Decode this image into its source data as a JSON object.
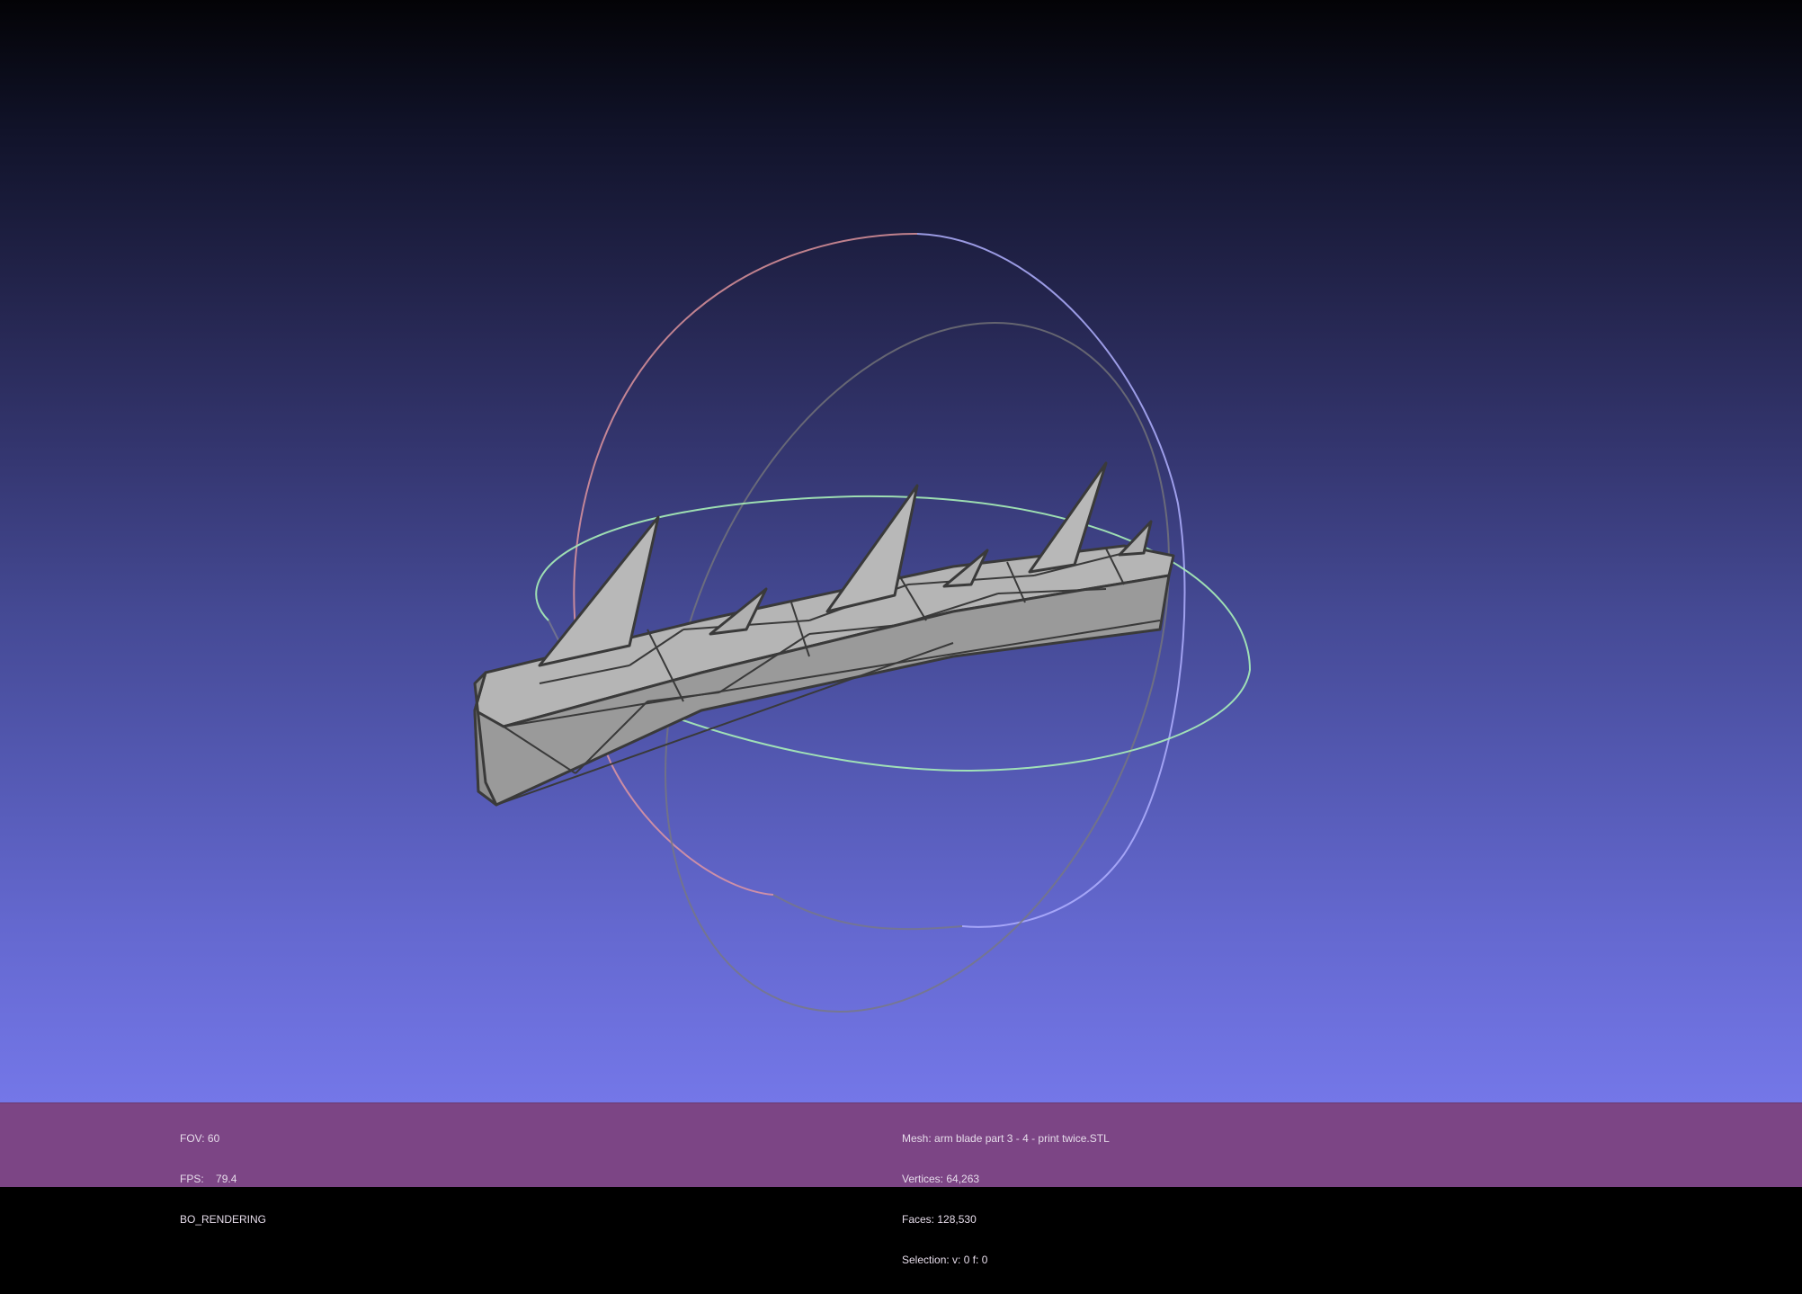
{
  "viewer": {
    "left_info": {
      "fov_label": "FOV:",
      "fov_value": "60",
      "fps_label": "FPS:",
      "fps_value": "79.4",
      "render_mode": "BO_RENDERING"
    },
    "right_info": {
      "mesh_label": "Mesh:",
      "mesh_name": "arm blade part 3 - 4 - print twice.STL",
      "vertices_label": "Vertices:",
      "vertices_value": "64,263",
      "faces_label": "Faces:",
      "faces_value": "128,530",
      "selection_label": "Selection:",
      "selection_value": "v: 0 f: 0"
    }
  },
  "colors": {
    "background_top": "#030306",
    "background_bottom": "#7477e8",
    "status_bar": "#7c4585",
    "mesh_fill": "#a9a9a9",
    "mesh_edges": "#3a3a3a",
    "trackball_x": "#e89aa0",
    "trackball_y": "#a8a8ff",
    "trackball_z": "#a8f0b8",
    "trackball_gray": "#787878"
  },
  "icons": {
    "trackball": "trackball-gizmo-icon",
    "mesh": "mesh-model-icon"
  }
}
